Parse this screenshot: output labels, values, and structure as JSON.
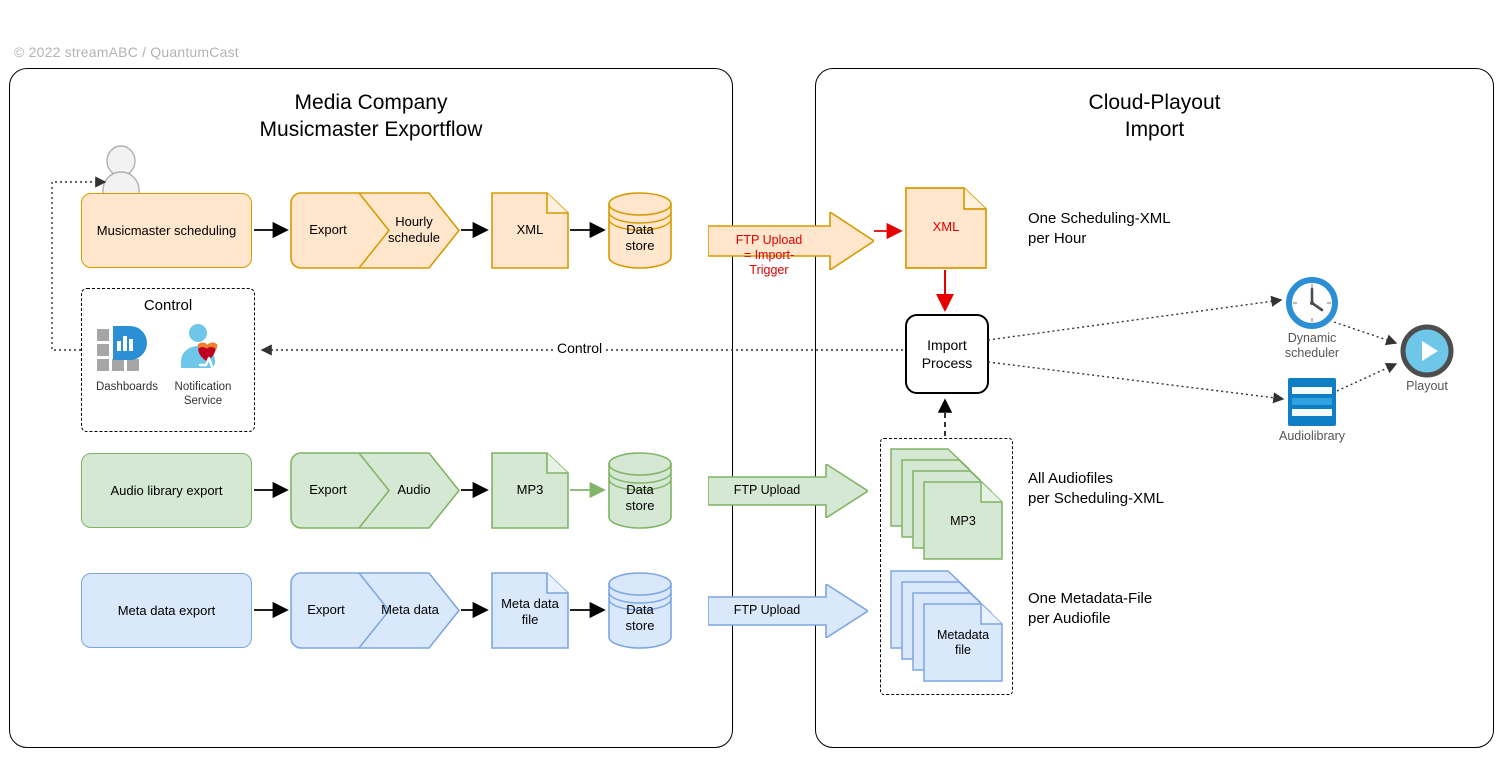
{
  "copyright": "© 2022 streamABC / QuantumCast",
  "panels": {
    "left": {
      "title": "Media Company\nMusicmaster Exportflow"
    },
    "right": {
      "title": "Cloud-Playout\nImport"
    }
  },
  "colors": {
    "orange_fill": "#ffe6cc",
    "orange_stroke": "#d79b00",
    "green_fill": "#d5e8d4",
    "green_stroke": "#82b366",
    "blue_fill": "#dae8fc",
    "blue_stroke": "#7ea6e0",
    "red_accent": "#e60000",
    "icon_blue": "#2a8fd4",
    "icon_light_blue": "#6ec6e8",
    "icon_dark": "#4d4d4d",
    "copyright_gray": "#b3b3b3"
  },
  "rows": {
    "scheduling": {
      "source_label": "Musicmaster scheduling",
      "step_left": "Export",
      "step_right": "Hourly\nschedule",
      "document": "XML",
      "store": "Data\nstore",
      "ftp_label": "FTP Upload",
      "ftp_sub": "= Import-\nTrigger",
      "target_document": "XML",
      "note": "One Scheduling-XML\nper Hour"
    },
    "audio": {
      "source_label": "Audio library export",
      "step_left": "Export",
      "step_right": "Audio",
      "document": "MP3",
      "store": "Data\nstore",
      "ftp_label": "FTP Upload",
      "stack_label": "MP3",
      "note": "All Audiofiles\nper Scheduling-XML"
    },
    "metadata": {
      "source_label": "Meta data export",
      "step_left": "Export",
      "step_right": "Meta data",
      "document": "Meta data\nfile",
      "store": "Data\nstore",
      "ftp_label": "FTP Upload",
      "stack_label": "Metadata\nfile",
      "note": "One Metadata-File\nper Audiofile"
    }
  },
  "control": {
    "title": "Control",
    "dashboards_label": "Dashboards",
    "notification_label": "Notification\nService",
    "wire_label": "Control"
  },
  "import": {
    "process_label": "Import\nProcess"
  },
  "playout": {
    "scheduler_label": "Dynamic\nscheduler",
    "audiolibrary_label": "Audiolibrary",
    "playout_label": "Playout"
  },
  "icons": {
    "actor": "person-icon",
    "dashboards": "dashboard-chart-icon",
    "notification": "notification-heartbeat-icon",
    "scheduler": "clock-icon",
    "audiolibrary": "audio-library-icon",
    "playout": "play-button-icon"
  }
}
